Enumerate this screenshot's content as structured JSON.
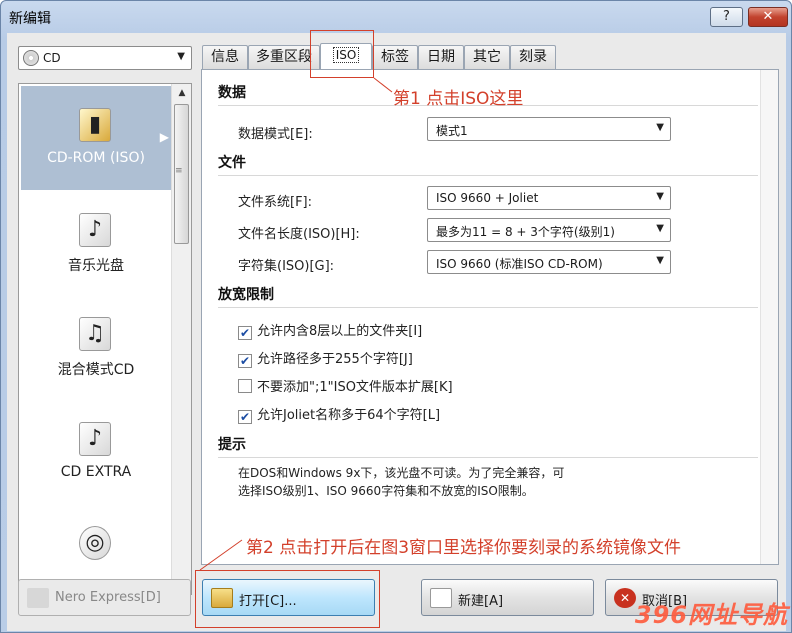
{
  "window": {
    "title": "新编辑",
    "help_glyph": "?",
    "close_glyph": "✕"
  },
  "left": {
    "disc_type": "CD",
    "items": [
      {
        "label": "CD-ROM (ISO)",
        "icon": "cd-rom-iso-icon"
      },
      {
        "label": "音乐光盘",
        "icon": "music-disc-icon"
      },
      {
        "label": "混合模式CD",
        "icon": "mixed-mode-cd-icon"
      },
      {
        "label": "CD EXTRA",
        "icon": "cd-extra-icon"
      },
      {
        "label": "",
        "icon": "disc-icon"
      }
    ]
  },
  "tabs": [
    "信息",
    "多重区段",
    "ISO",
    "标签",
    "日期",
    "其它",
    "刻录"
  ],
  "iso": {
    "data_section": "数据",
    "data_mode_label": "数据模式[E]:",
    "data_mode_value": "模式1",
    "file_section": "文件",
    "fs_label": "文件系统[F]:",
    "fs_value": "ISO 9660 + Joliet",
    "name_len_label": "文件名长度(ISO)[H]:",
    "name_len_value": "最多为11 = 8 + 3个字符(级别1)",
    "charset_label": "字符集(ISO)[G]:",
    "charset_value": "ISO 9660 (标准ISO CD-ROM)",
    "relax_section": "放宽限制",
    "options": [
      {
        "label": "允许内含8层以上的文件夹[I]",
        "checked": true
      },
      {
        "label": "允许路径多于255个字符[J]",
        "checked": true
      },
      {
        "label": "不要添加\";1\"ISO文件版本扩展[K]",
        "checked": false
      },
      {
        "label": "允许Joliet名称多于64个字符[L]",
        "checked": true
      }
    ],
    "hint_section": "提示",
    "hint_line1": "在DOS和Windows 9x下，该光盘不可读。为了完全兼容，可",
    "hint_line2": "选择ISO级别1、ISO 9660字符集和不放宽的ISO限制。"
  },
  "buttons": {
    "nero_express": "Nero Express[D]",
    "open": "打开[C]...",
    "new": "新建[A]",
    "cancel": "取消[B]"
  },
  "annotations": {
    "step1": "第1 点击ISO这里",
    "step2": "第2  点击打开后在图3窗口里选择你要刻录的系统镜像文件"
  },
  "watermark": "396网址导航",
  "colors": {
    "annotation": "#d3402b",
    "selection": "#aebfd3"
  }
}
